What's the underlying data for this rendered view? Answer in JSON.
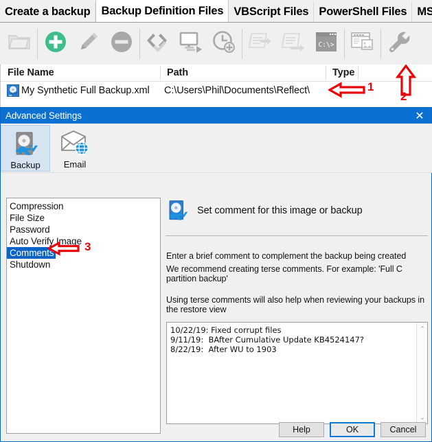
{
  "tabs": [
    {
      "label": "Create a backup",
      "active": false
    },
    {
      "label": "Backup Definition Files",
      "active": true
    },
    {
      "label": "VBScript Files",
      "active": false
    },
    {
      "label": "PowerShell Files",
      "active": false
    },
    {
      "label": "MS",
      "active": false
    }
  ],
  "toolbar": {
    "buttons": [
      {
        "name": "open-folder-button",
        "icon": "folder-icon",
        "enabled": false
      },
      {
        "name": "add-button",
        "icon": "plus-circle-icon",
        "enabled": true
      },
      {
        "name": "edit-button",
        "icon": "pencil-icon",
        "enabled": true
      },
      {
        "name": "delete-button",
        "icon": "minus-circle-icon",
        "enabled": true
      },
      {
        "name": "validate-button",
        "icon": "code-check-icon",
        "enabled": true
      },
      {
        "name": "run-button",
        "icon": "monitor-run-icon",
        "enabled": true
      },
      {
        "name": "schedule-button",
        "icon": "clock-add-icon",
        "enabled": true
      },
      {
        "name": "script-vb-button",
        "icon": "script-arrow-icon",
        "enabled": false
      },
      {
        "name": "script-ps-button",
        "icon": "script-arrow2-icon",
        "enabled": false
      },
      {
        "name": "command-prompt-button",
        "icon": "console-icon",
        "enabled": true
      },
      {
        "name": "window-layout-button",
        "icon": "window-image-icon",
        "enabled": true
      },
      {
        "name": "advanced-settings-button",
        "icon": "wrench-icon",
        "enabled": true
      }
    ]
  },
  "filelist": {
    "columns": [
      "File Name",
      "Path",
      "Type"
    ],
    "rows": [
      {
        "file_name": "My Synthetic Full Backup.xml",
        "path": "C:\\Users\\Phil\\Documents\\Reflect\\",
        "type": ""
      }
    ]
  },
  "annotations": [
    {
      "number": "1",
      "points_to": "path-cell",
      "direction": "left"
    },
    {
      "number": "2",
      "points_to": "advanced-settings-button",
      "direction": "up"
    },
    {
      "number": "3",
      "points_to": "category-comments",
      "direction": "left"
    }
  ],
  "dialog": {
    "title": "Advanced Settings",
    "close_label": "✕",
    "ribbon": [
      {
        "label": "Backup",
        "icon": "disk-sync-icon",
        "selected": true
      },
      {
        "label": "Email",
        "icon": "email-globe-icon",
        "selected": false
      }
    ],
    "categories": [
      {
        "label": "Compression",
        "selected": false
      },
      {
        "label": "File Size",
        "selected": false
      },
      {
        "label": "Password",
        "selected": false
      },
      {
        "label": "Auto Verify Image",
        "selected": false
      },
      {
        "label": "Comments",
        "selected": true
      },
      {
        "label": "Shutdown",
        "selected": false
      }
    ],
    "pane": {
      "heading": "Set comment for this image or backup",
      "heading_icon": "disk-sync-icon",
      "line1": "Enter a brief comment to complement the backup being created",
      "line2": "We recommend creating terse comments. For example: 'Full C partition backup'",
      "line3": "Using terse comments will also help when reviewing your backups in the restore view",
      "comment_value": "10/22/19: Fixed corrupt files\n9/11/19:  BAfter Cumulative Update KB4524147?\n8/22/19:  After WU to 1903",
      "scroll_up": "⌃",
      "scroll_down": "⌄"
    },
    "buttons": [
      {
        "label": "Help",
        "default": false
      },
      {
        "label": "OK",
        "default": true
      },
      {
        "label": "Cancel",
        "default": false
      }
    ]
  },
  "colors": {
    "title_bar": "#0a70d2",
    "selection": "#0a64c8",
    "annotation_red": "#e8060b",
    "add_green": "#3dbd8a",
    "toolbar_bg": "#f0f0f0"
  }
}
